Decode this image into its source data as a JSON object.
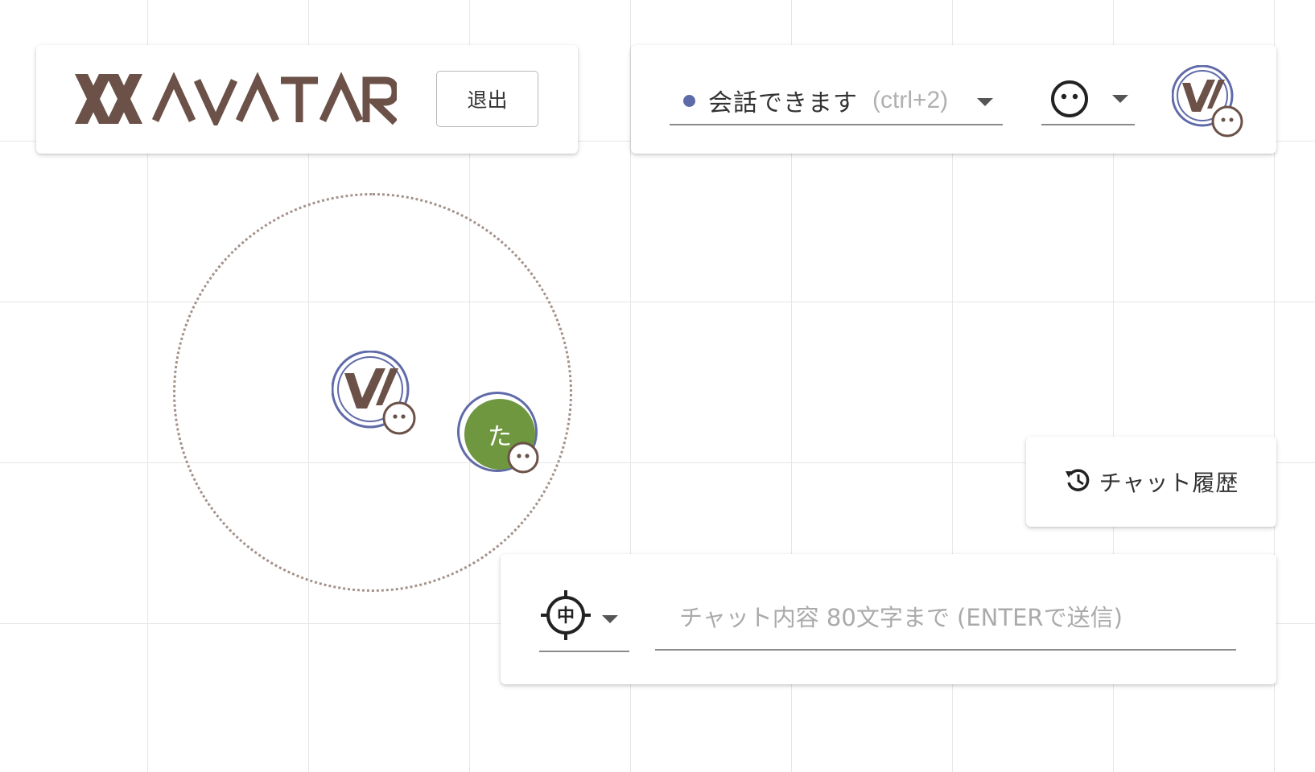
{
  "header": {
    "logo_text": "AVATAR",
    "logout_label": "退出"
  },
  "status": {
    "label": "会話できます",
    "shortcut": "(ctrl+2)",
    "dot_color": "#5f6aa8",
    "emoji_icon": "neutral-face-icon"
  },
  "map": {
    "other_user_initial": "た",
    "other_user_color": "#6f9740",
    "ring_color": "#5f6aa8",
    "range_color": "#a3928a"
  },
  "chat_history": {
    "label": "チャット履歴",
    "icon": "history-icon"
  },
  "chat_input": {
    "placeholder": "チャット内容 80文字まで (ENTERで送信)",
    "target_icon": "crosshair-center-icon",
    "target_glyph": "中"
  },
  "colors": {
    "brand_brown": "#6b5147",
    "accent": "#5f6aa8"
  }
}
